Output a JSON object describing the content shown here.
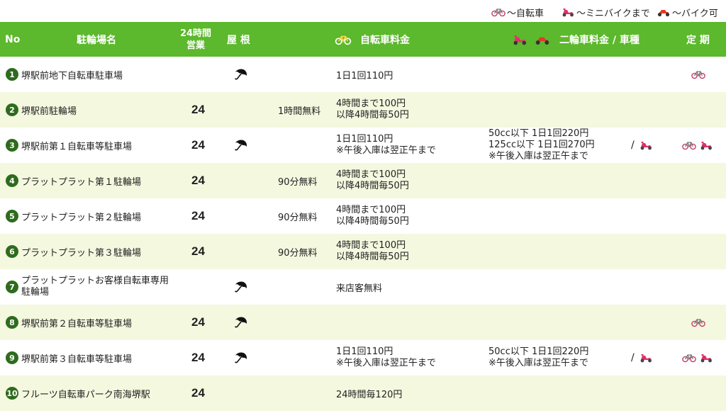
{
  "legend": {
    "bicycle": "～自転車",
    "minibike": "～ミニバイクまで",
    "bike": "～バイク可"
  },
  "header": {
    "no": "No",
    "name": "駐輪場名",
    "open24_line1": "24時間",
    "open24_line2": "営業",
    "roof": "屋 根",
    "bicycle_fee": "自転車料金",
    "moto_fee": "二輪車料金 / 車種",
    "pass": "定 期"
  },
  "colors": {
    "header_bg": "#5cb82c",
    "row_alt_bg": "#f4f8df",
    "number_badge": "#2f6b1e",
    "scooter": "#e0306a",
    "motorbike": "#e03a2a"
  },
  "icons": {
    "roof": "umbrella-icon",
    "bicycle": "bicycle-icon",
    "scooter": "scooter-icon",
    "motorbike": "motorbike-icon"
  },
  "rows": [
    {
      "no": "1",
      "name": [
        "堺駅前地下自転車駐車場"
      ],
      "h24": "",
      "roof": true,
      "free": "",
      "fee": [
        "1日1回110円"
      ],
      "moto": [],
      "moto_type": false,
      "pass_bicycle": true,
      "pass_scooter": false
    },
    {
      "no": "2",
      "name": [
        "堺駅前駐輪場"
      ],
      "h24": "24",
      "roof": false,
      "free": "1時間無料",
      "fee": [
        "4時間まで100円",
        "以降4時間毎50円"
      ],
      "moto": [],
      "moto_type": false,
      "pass_bicycle": false,
      "pass_scooter": false
    },
    {
      "no": "3",
      "name": [
        "堺駅前第１自転車等駐車場"
      ],
      "h24": "24",
      "roof": true,
      "free": "",
      "fee": [
        "1日1回110円",
        "※午後入庫は翌正午まで"
      ],
      "moto": [
        "50cc以下 1日1回220円",
        "125cc以下 1日1回270円",
        "※午後入庫は翌正午まで"
      ],
      "moto_type": true,
      "pass_bicycle": true,
      "pass_scooter": true
    },
    {
      "no": "4",
      "name": [
        "プラットプラット第１駐輪場"
      ],
      "h24": "24",
      "roof": false,
      "free": "90分無料",
      "fee": [
        "4時間まで100円",
        "以降4時間毎50円"
      ],
      "moto": [],
      "moto_type": false,
      "pass_bicycle": false,
      "pass_scooter": false
    },
    {
      "no": "5",
      "name": [
        "プラットプラット第２駐輪場"
      ],
      "h24": "24",
      "roof": false,
      "free": "90分無料",
      "fee": [
        "4時間まで100円",
        "以降4時間毎50円"
      ],
      "moto": [],
      "moto_type": false,
      "pass_bicycle": false,
      "pass_scooter": false
    },
    {
      "no": "6",
      "name": [
        "プラットプラット第３駐輪場"
      ],
      "h24": "24",
      "roof": false,
      "free": "90分無料",
      "fee": [
        "4時間まで100円",
        "以降4時間毎50円"
      ],
      "moto": [],
      "moto_type": false,
      "pass_bicycle": false,
      "pass_scooter": false
    },
    {
      "no": "7",
      "name": [
        "プラットプラットお客様自転車専用",
        "駐輪場"
      ],
      "h24": "",
      "roof": true,
      "free": "",
      "fee": [
        "来店客無料"
      ],
      "moto": [],
      "moto_type": false,
      "pass_bicycle": false,
      "pass_scooter": false
    },
    {
      "no": "8",
      "name": [
        "堺駅前第２自転車等駐車場"
      ],
      "h24": "24",
      "roof": true,
      "free": "",
      "fee": [],
      "moto": [],
      "moto_type": false,
      "pass_bicycle": true,
      "pass_scooter": false
    },
    {
      "no": "9",
      "name": [
        "堺駅前第３自転車等駐車場"
      ],
      "h24": "24",
      "roof": true,
      "free": "",
      "fee": [
        "1日1回110円",
        "※午後入庫は翌正午まで"
      ],
      "moto": [
        "50cc以下 1日1回220円",
        "※午後入庫は翌正午まで"
      ],
      "moto_type": true,
      "pass_bicycle": true,
      "pass_scooter": true
    },
    {
      "no": "10",
      "name": [
        "フルーツ自転車パーク南海堺駅"
      ],
      "h24": "24",
      "roof": false,
      "free": "",
      "fee": [
        "24時間毎120円"
      ],
      "moto": [],
      "moto_type": false,
      "pass_bicycle": false,
      "pass_scooter": false
    }
  ]
}
